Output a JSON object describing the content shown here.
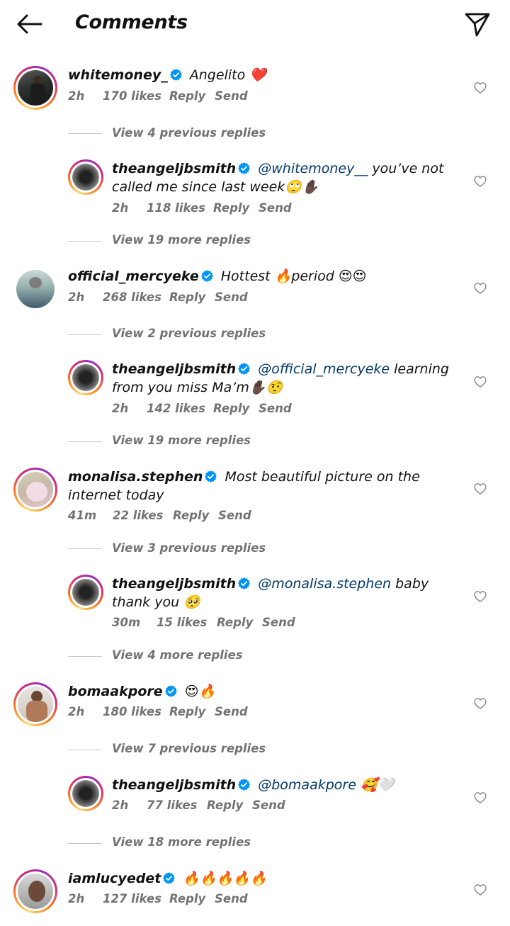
{
  "header": {
    "title": "Comments"
  },
  "colors": {
    "mention": "#00376b",
    "verified": "#0095f6",
    "meta": "#737373"
  },
  "labels": {
    "reply": "Reply",
    "send": "Send"
  },
  "comments": [
    {
      "username": "whitemoney_",
      "text": "Angelito ❤️",
      "time": "2h",
      "likes": "170 likes",
      "view_replies": "View 4 previous replies",
      "reply": {
        "username": "theangeljbsmith",
        "mention": "@whitemoney__",
        "text": " you’ve not called me since last week🙄✋🏿",
        "time": "2h",
        "likes": "118 likes",
        "more": "View 19 more replies"
      }
    },
    {
      "username": "official_mercyeke",
      "text": "Hottest 🔥period 😍😍",
      "time": "2h",
      "likes": "268 likes",
      "view_replies": "View 2 previous replies",
      "reply": {
        "username": "theangeljbsmith",
        "mention": "@official_mercyeke",
        "text": " learning from you miss Ma’m✋🏿🤨",
        "time": "2h",
        "likes": "142 likes",
        "more": "View 19 more replies"
      }
    },
    {
      "username": "monalisa.stephen",
      "text": "Most beautiful picture on the internet today",
      "time": "41m",
      "likes": "22 likes",
      "view_replies": "View 3 previous replies",
      "reply": {
        "username": "theangeljbsmith",
        "mention": "@monalisa.stephen",
        "text": " baby thank you 🥺",
        "time": "30m",
        "likes": "15 likes",
        "more": "View 4 more replies"
      }
    },
    {
      "username": "bomaakpore",
      "text": "😍🔥",
      "time": "2h",
      "likes": "180 likes",
      "view_replies": "View 7 previous replies",
      "reply": {
        "username": "theangeljbsmith",
        "mention": "@bomaakpore",
        "text": " 🥰🤍",
        "time": "2h",
        "likes": "77 likes",
        "more": "View 18 more replies"
      }
    },
    {
      "username": "iamlucyedet",
      "text": "🔥🔥🔥🔥🔥",
      "time": "2h",
      "likes": "127 likes"
    }
  ]
}
